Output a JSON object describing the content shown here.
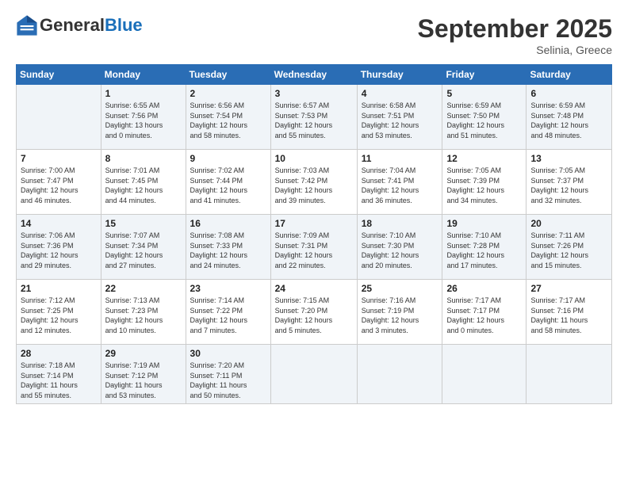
{
  "logo": {
    "general": "General",
    "blue": "Blue"
  },
  "title": "September 2025",
  "location": "Selinia, Greece",
  "days_header": [
    "Sunday",
    "Monday",
    "Tuesday",
    "Wednesday",
    "Thursday",
    "Friday",
    "Saturday"
  ],
  "weeks": [
    [
      {
        "day": "",
        "info": ""
      },
      {
        "day": "1",
        "info": "Sunrise: 6:55 AM\nSunset: 7:56 PM\nDaylight: 13 hours\nand 0 minutes."
      },
      {
        "day": "2",
        "info": "Sunrise: 6:56 AM\nSunset: 7:54 PM\nDaylight: 12 hours\nand 58 minutes."
      },
      {
        "day": "3",
        "info": "Sunrise: 6:57 AM\nSunset: 7:53 PM\nDaylight: 12 hours\nand 55 minutes."
      },
      {
        "day": "4",
        "info": "Sunrise: 6:58 AM\nSunset: 7:51 PM\nDaylight: 12 hours\nand 53 minutes."
      },
      {
        "day": "5",
        "info": "Sunrise: 6:59 AM\nSunset: 7:50 PM\nDaylight: 12 hours\nand 51 minutes."
      },
      {
        "day": "6",
        "info": "Sunrise: 6:59 AM\nSunset: 7:48 PM\nDaylight: 12 hours\nand 48 minutes."
      }
    ],
    [
      {
        "day": "7",
        "info": "Sunrise: 7:00 AM\nSunset: 7:47 PM\nDaylight: 12 hours\nand 46 minutes."
      },
      {
        "day": "8",
        "info": "Sunrise: 7:01 AM\nSunset: 7:45 PM\nDaylight: 12 hours\nand 44 minutes."
      },
      {
        "day": "9",
        "info": "Sunrise: 7:02 AM\nSunset: 7:44 PM\nDaylight: 12 hours\nand 41 minutes."
      },
      {
        "day": "10",
        "info": "Sunrise: 7:03 AM\nSunset: 7:42 PM\nDaylight: 12 hours\nand 39 minutes."
      },
      {
        "day": "11",
        "info": "Sunrise: 7:04 AM\nSunset: 7:41 PM\nDaylight: 12 hours\nand 36 minutes."
      },
      {
        "day": "12",
        "info": "Sunrise: 7:05 AM\nSunset: 7:39 PM\nDaylight: 12 hours\nand 34 minutes."
      },
      {
        "day": "13",
        "info": "Sunrise: 7:05 AM\nSunset: 7:37 PM\nDaylight: 12 hours\nand 32 minutes."
      }
    ],
    [
      {
        "day": "14",
        "info": "Sunrise: 7:06 AM\nSunset: 7:36 PM\nDaylight: 12 hours\nand 29 minutes."
      },
      {
        "day": "15",
        "info": "Sunrise: 7:07 AM\nSunset: 7:34 PM\nDaylight: 12 hours\nand 27 minutes."
      },
      {
        "day": "16",
        "info": "Sunrise: 7:08 AM\nSunset: 7:33 PM\nDaylight: 12 hours\nand 24 minutes."
      },
      {
        "day": "17",
        "info": "Sunrise: 7:09 AM\nSunset: 7:31 PM\nDaylight: 12 hours\nand 22 minutes."
      },
      {
        "day": "18",
        "info": "Sunrise: 7:10 AM\nSunset: 7:30 PM\nDaylight: 12 hours\nand 20 minutes."
      },
      {
        "day": "19",
        "info": "Sunrise: 7:10 AM\nSunset: 7:28 PM\nDaylight: 12 hours\nand 17 minutes."
      },
      {
        "day": "20",
        "info": "Sunrise: 7:11 AM\nSunset: 7:26 PM\nDaylight: 12 hours\nand 15 minutes."
      }
    ],
    [
      {
        "day": "21",
        "info": "Sunrise: 7:12 AM\nSunset: 7:25 PM\nDaylight: 12 hours\nand 12 minutes."
      },
      {
        "day": "22",
        "info": "Sunrise: 7:13 AM\nSunset: 7:23 PM\nDaylight: 12 hours\nand 10 minutes."
      },
      {
        "day": "23",
        "info": "Sunrise: 7:14 AM\nSunset: 7:22 PM\nDaylight: 12 hours\nand 7 minutes."
      },
      {
        "day": "24",
        "info": "Sunrise: 7:15 AM\nSunset: 7:20 PM\nDaylight: 12 hours\nand 5 minutes."
      },
      {
        "day": "25",
        "info": "Sunrise: 7:16 AM\nSunset: 7:19 PM\nDaylight: 12 hours\nand 3 minutes."
      },
      {
        "day": "26",
        "info": "Sunrise: 7:17 AM\nSunset: 7:17 PM\nDaylight: 12 hours\nand 0 minutes."
      },
      {
        "day": "27",
        "info": "Sunrise: 7:17 AM\nSunset: 7:16 PM\nDaylight: 11 hours\nand 58 minutes."
      }
    ],
    [
      {
        "day": "28",
        "info": "Sunrise: 7:18 AM\nSunset: 7:14 PM\nDaylight: 11 hours\nand 55 minutes."
      },
      {
        "day": "29",
        "info": "Sunrise: 7:19 AM\nSunset: 7:12 PM\nDaylight: 11 hours\nand 53 minutes."
      },
      {
        "day": "30",
        "info": "Sunrise: 7:20 AM\nSunset: 7:11 PM\nDaylight: 11 hours\nand 50 minutes."
      },
      {
        "day": "",
        "info": ""
      },
      {
        "day": "",
        "info": ""
      },
      {
        "day": "",
        "info": ""
      },
      {
        "day": "",
        "info": ""
      }
    ]
  ]
}
